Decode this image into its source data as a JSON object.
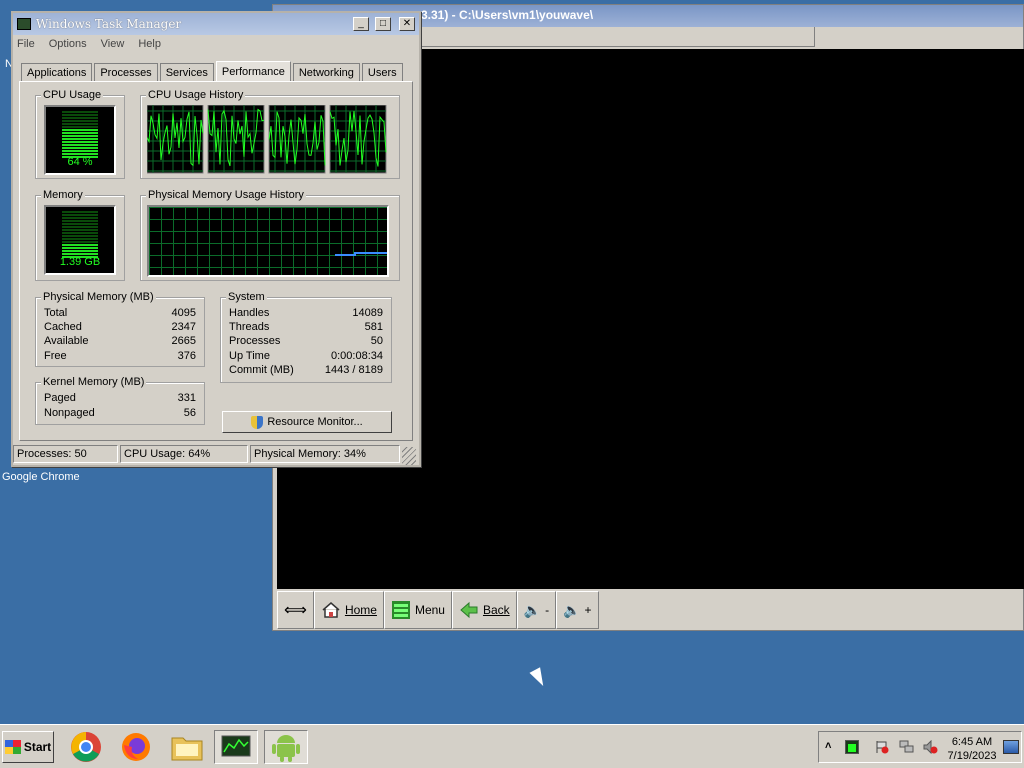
{
  "desktop": {
    "icon_label": "Google Chrome",
    "left_fragment": "N"
  },
  "emulator": {
    "title": "3.31) - C:\\Users\\vm1\\youwave\\",
    "toolbar": {
      "home_label": "Home",
      "menu_label": "Menu",
      "back_label": "Back",
      "vol_down_label": "-",
      "vol_up_label": "+"
    }
  },
  "task_manager": {
    "title": "Windows Task Manager",
    "menu": [
      "File",
      "Options",
      "View",
      "Help"
    ],
    "tabs": [
      "Applications",
      "Processes",
      "Services",
      "Performance",
      "Networking",
      "Users"
    ],
    "active_tab": "Performance",
    "cpu_usage": {
      "label": "CPU Usage",
      "value": "64 %",
      "percent": 64
    },
    "cpu_history": {
      "label": "CPU Usage History"
    },
    "memory": {
      "label": "Memory",
      "value": "1.39 GB",
      "fraction": 0.34
    },
    "memory_history": {
      "label": "Physical Memory Usage History"
    },
    "physical_memory": {
      "title": "Physical Memory (MB)",
      "rows": [
        {
          "label": "Total",
          "value": "4095"
        },
        {
          "label": "Cached",
          "value": "2347"
        },
        {
          "label": "Available",
          "value": "2665"
        },
        {
          "label": "Free",
          "value": "376"
        }
      ]
    },
    "kernel_memory": {
      "title": "Kernel Memory (MB)",
      "rows": [
        {
          "label": "Paged",
          "value": "331"
        },
        {
          "label": "Nonpaged",
          "value": "56"
        }
      ]
    },
    "system": {
      "title": "System",
      "rows": [
        {
          "label": "Handles",
          "value": "14089"
        },
        {
          "label": "Threads",
          "value": "581"
        },
        {
          "label": "Processes",
          "value": "50"
        },
        {
          "label": "Up Time",
          "value": "0:00:08:34"
        },
        {
          "label": "Commit (MB)",
          "value": "1443 / 8189"
        }
      ]
    },
    "resource_monitor_label": "Resource Monitor...",
    "status": {
      "processes": "Processes: 50",
      "cpu": "CPU Usage: 64%",
      "memory": "Physical Memory: 34%"
    }
  },
  "taskbar": {
    "start_label": "Start",
    "clock_time": "6:45 AM",
    "clock_date": "7/19/2023"
  },
  "colors": {
    "desktop": "#3a6ea5",
    "graph_line": "#22ff22",
    "memory_line": "#3a8cff"
  }
}
